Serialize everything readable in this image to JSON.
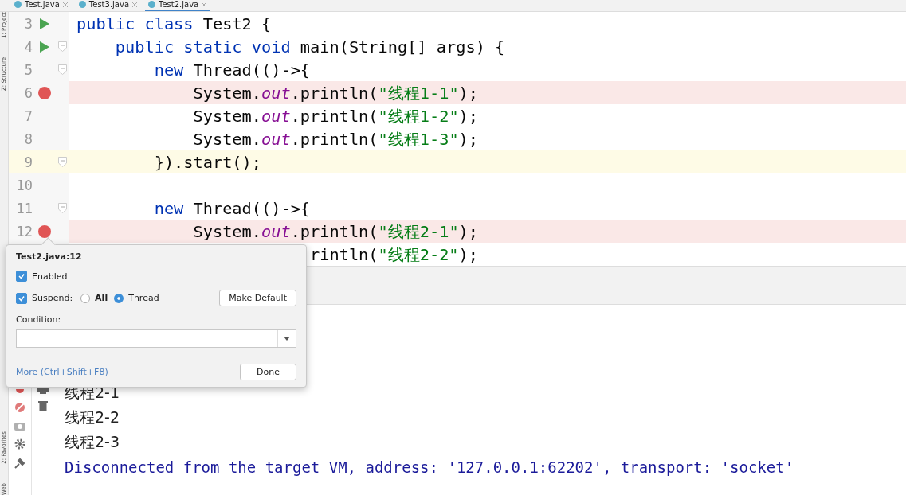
{
  "tabs": [
    {
      "label": "Test.java",
      "selected": false
    },
    {
      "label": "Test3.java",
      "selected": false
    },
    {
      "label": "Test2.java",
      "selected": true
    }
  ],
  "side_strip": {
    "top": [
      "1: Project",
      "Z: Structure"
    ],
    "bottom": [
      "2: Favorites",
      "Web"
    ]
  },
  "editor": {
    "lines": [
      {
        "number": "3",
        "run": true,
        "breakpoint": false,
        "fold": false,
        "current": false,
        "tokens": [
          {
            "kind": "keyword",
            "text": "public class "
          },
          {
            "kind": "plain",
            "text": "Test2 {"
          }
        ]
      },
      {
        "number": "4",
        "run": true,
        "breakpoint": false,
        "fold": true,
        "current": false,
        "tokens": [
          {
            "kind": "keyword",
            "text": "    public static void "
          },
          {
            "kind": "plain",
            "text": "main(String[] args) {"
          }
        ]
      },
      {
        "number": "5",
        "run": false,
        "breakpoint": false,
        "fold": true,
        "current": false,
        "tokens": [
          {
            "kind": "keyword",
            "text": "        new "
          },
          {
            "kind": "plain",
            "text": "Thread(()->{"
          }
        ]
      },
      {
        "number": "6",
        "run": false,
        "breakpoint": true,
        "fold": false,
        "current": false,
        "tokens": [
          {
            "kind": "plain",
            "text": "            System."
          },
          {
            "kind": "field",
            "text": "out"
          },
          {
            "kind": "plain",
            "text": ".println("
          },
          {
            "kind": "string",
            "text": "\"线程1-1\""
          },
          {
            "kind": "plain",
            "text": ");"
          }
        ]
      },
      {
        "number": "7",
        "run": false,
        "breakpoint": false,
        "fold": false,
        "current": false,
        "tokens": [
          {
            "kind": "plain",
            "text": "            System."
          },
          {
            "kind": "field",
            "text": "out"
          },
          {
            "kind": "plain",
            "text": ".println("
          },
          {
            "kind": "string",
            "text": "\"线程1-2\""
          },
          {
            "kind": "plain",
            "text": ");"
          }
        ]
      },
      {
        "number": "8",
        "run": false,
        "breakpoint": false,
        "fold": false,
        "current": false,
        "tokens": [
          {
            "kind": "plain",
            "text": "            System."
          },
          {
            "kind": "field",
            "text": "out"
          },
          {
            "kind": "plain",
            "text": ".println("
          },
          {
            "kind": "string",
            "text": "\"线程1-3\""
          },
          {
            "kind": "plain",
            "text": ");"
          }
        ]
      },
      {
        "number": "9",
        "run": false,
        "breakpoint": false,
        "fold": true,
        "current": true,
        "tokens": [
          {
            "kind": "plain",
            "text": "        }).start();"
          }
        ]
      },
      {
        "number": "10",
        "run": false,
        "breakpoint": false,
        "fold": false,
        "current": false
      },
      {
        "number": "11",
        "run": false,
        "breakpoint": false,
        "fold": true,
        "current": false,
        "tokens": [
          {
            "kind": "keyword",
            "text": "        new "
          },
          {
            "kind": "plain",
            "text": "Thread(()->{"
          }
        ]
      },
      {
        "number": "12",
        "run": false,
        "breakpoint": true,
        "fold": false,
        "current": false,
        "tokens": [
          {
            "kind": "plain",
            "text": "            System."
          },
          {
            "kind": "field",
            "text": "out"
          },
          {
            "kind": "plain",
            "text": ".println("
          },
          {
            "kind": "string",
            "text": "\"线程2-1\""
          },
          {
            "kind": "plain",
            "text": ");"
          }
        ]
      },
      {
        "run": false,
        "breakpoint": false,
        "fold": false,
        "current": false,
        "tokens": [
          {
            "kind": "plain",
            "text": "                        rintln("
          },
          {
            "kind": "string",
            "text": "\"线程2-2\""
          },
          {
            "kind": "plain",
            "text": ");"
          }
        ]
      }
    ]
  },
  "console": {
    "output": [
      {
        "kind": "text",
        "text": "线程2-1"
      },
      {
        "kind": "text",
        "text": "线程2-2"
      },
      {
        "kind": "text",
        "text": "线程2-3"
      },
      {
        "kind": "system",
        "text": "Disconnected from the target VM, address: '127.0.0.1:62202', transport: 'socket'"
      }
    ]
  },
  "breakpoint_popup": {
    "title": "Test2.java:12",
    "enabled": {
      "label": "Enabled",
      "checked": true
    },
    "suspend": {
      "label": "Suspend:",
      "checked": true
    },
    "suspend_options": [
      {
        "label": "All",
        "selected": false
      },
      {
        "label": "Thread",
        "selected": true
      }
    ],
    "make_default": "Make Default",
    "condition_label": "Condition:",
    "more_link": "More (Ctrl+Shift+F8)",
    "done": "Done"
  }
}
